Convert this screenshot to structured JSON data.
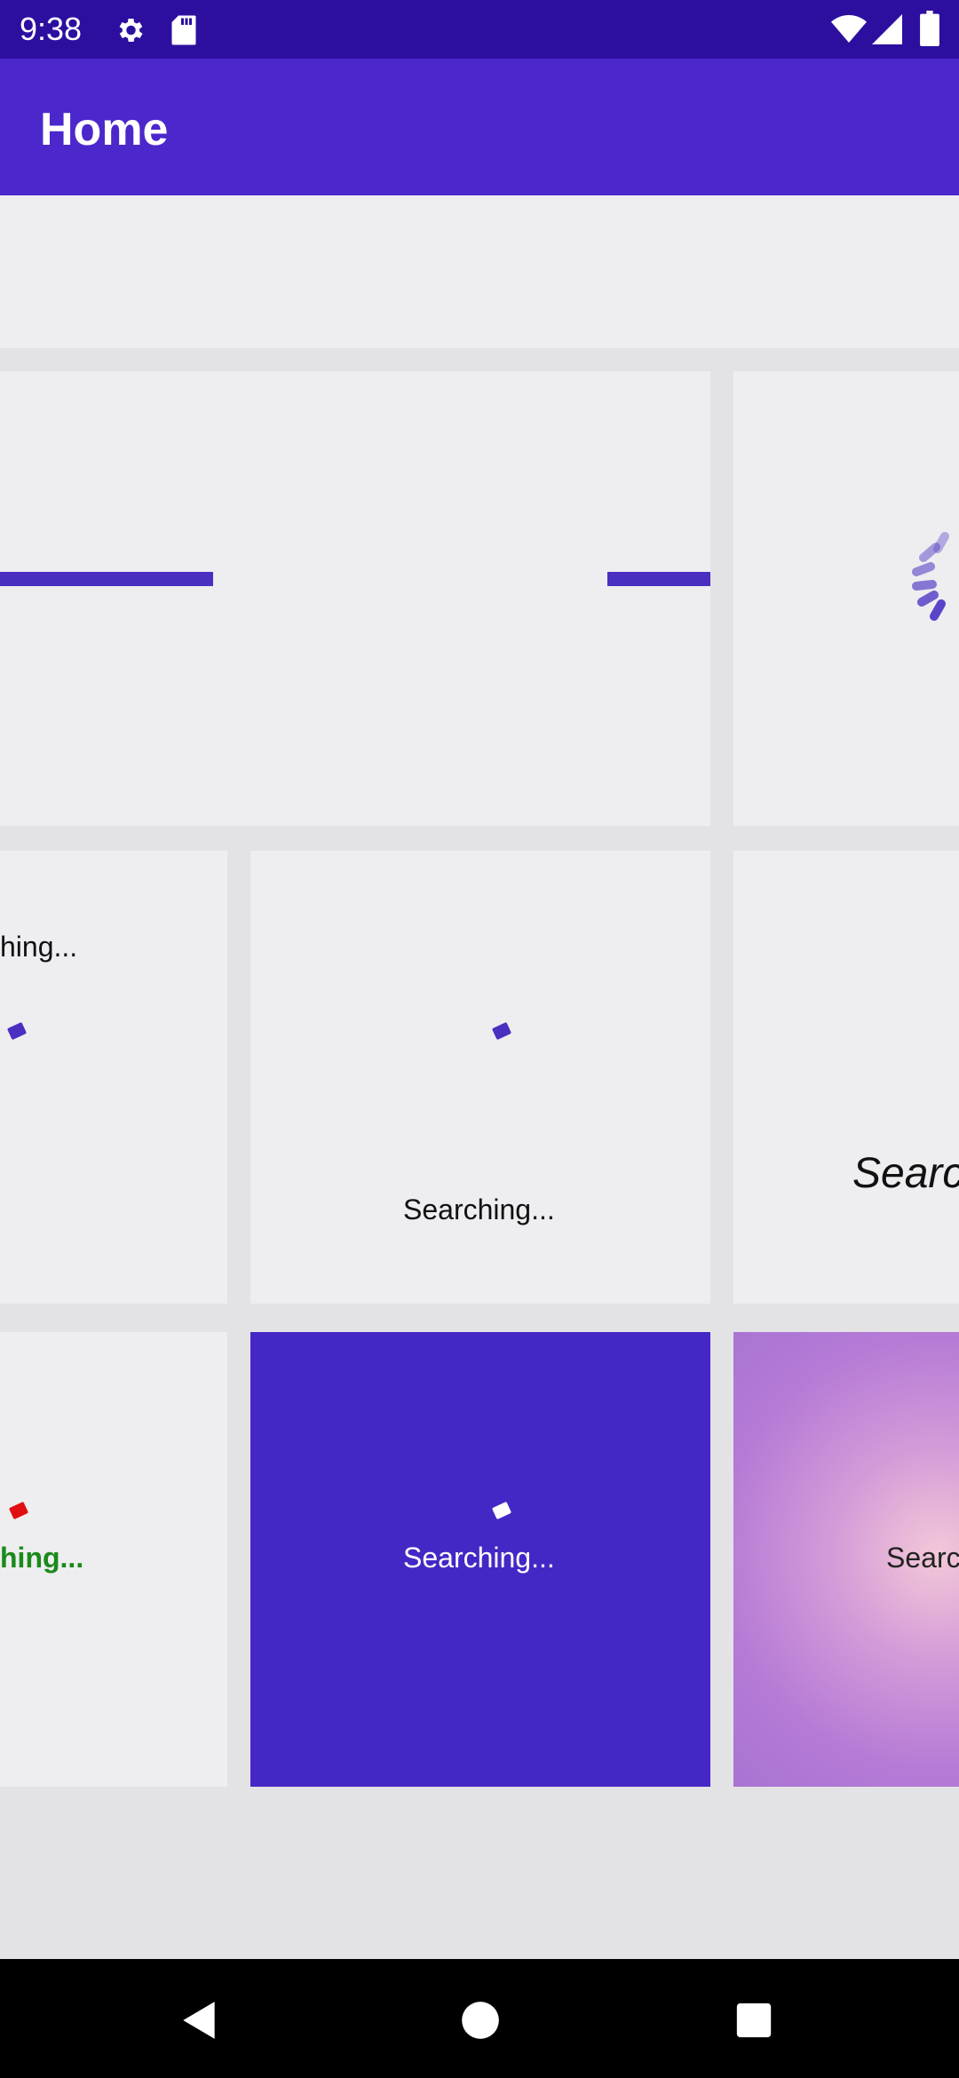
{
  "status_bar": {
    "time": "9:38",
    "icons": [
      "settings-icon",
      "sd-card-icon",
      "wifi-icon",
      "signal-icon",
      "battery-icon"
    ]
  },
  "app_bar": {
    "title": "Home"
  },
  "tiles": {
    "searching_partial_1": "hing...",
    "searching_full": "Searching...",
    "searching_italic_partial": "Searc",
    "searching_green_partial": "hing...",
    "searching_purple": "Searching...",
    "searching_gradient_partial": "Searc"
  },
  "nav_bar": {
    "icons": [
      "back-icon",
      "home-icon",
      "recents-icon"
    ]
  },
  "colors": {
    "status_bar": "#2d0fa0",
    "app_bar": "#4b27cc",
    "accent": "#4b2fc0",
    "purple_tile": "#4527c6",
    "green_text": "#1a8a1a",
    "red_dot": "#e01010"
  }
}
